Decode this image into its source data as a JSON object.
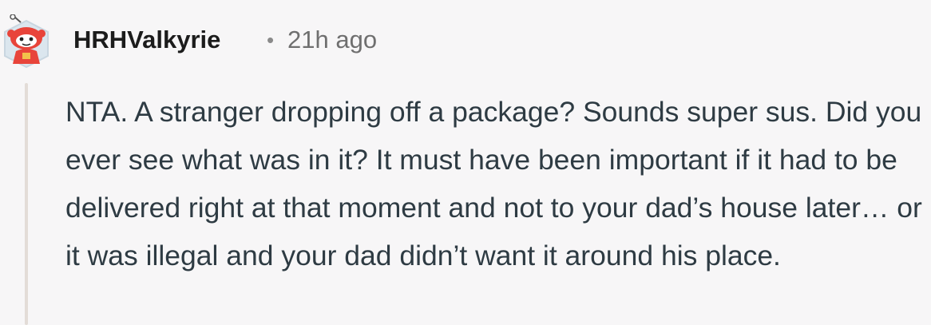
{
  "comment": {
    "username": "HRHValkyrie",
    "separator": "•",
    "timestamp": "21h ago",
    "avatar_icon": "snoo-avatar-icon",
    "body": "NTA. A stranger dropping off a package? Sounds super sus. Did you ever see what was in it? It must have been important if it had to be delivered right at that moment and not to your dad’s house later… or it was illegal and your dad didn’t want it around his place."
  },
  "colors": {
    "background": "#f7f6f7",
    "username": "#1c1c1c",
    "timestamp": "#6f6f6f",
    "body_text": "#2e3b43",
    "thread_line": "#e3dcd7",
    "avatar_accent": "#e8443a"
  }
}
